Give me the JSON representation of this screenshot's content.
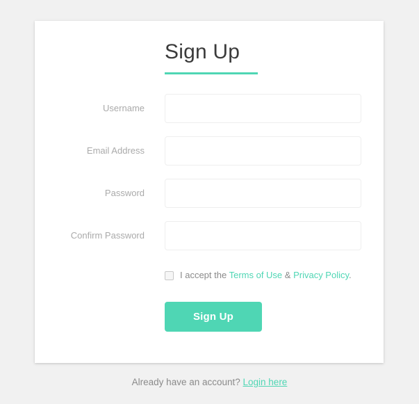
{
  "card": {
    "title": "Sign Up",
    "accent_color": "#4fd6b4",
    "fields": [
      {
        "label": "Username",
        "value": "",
        "placeholder": ""
      },
      {
        "label": "Email Address",
        "value": "",
        "placeholder": ""
      },
      {
        "label": "Password",
        "value": "",
        "placeholder": ""
      },
      {
        "label": "Confirm Password",
        "value": "",
        "placeholder": ""
      }
    ],
    "terms": {
      "checked": false,
      "prefix": "I accept the ",
      "terms_link": "Terms of Use",
      "separator": " & ",
      "privacy_link": "Privacy Policy",
      "suffix": "."
    },
    "submit_label": "Sign Up"
  },
  "footer": {
    "text": "Already have an account? ",
    "link_label": "Login here"
  }
}
